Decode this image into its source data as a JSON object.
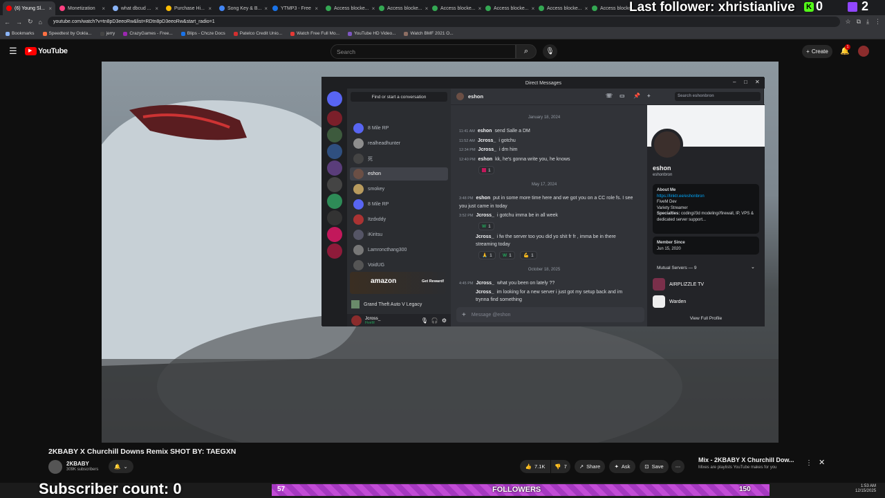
{
  "browser": {
    "tabs": [
      {
        "label": "(6) Young Sl...",
        "color": "#ff0000"
      },
      {
        "label": "Monetization",
        "color": "#ff4081"
      },
      {
        "label": "what dbcud ...",
        "color": "#8ab4f8"
      },
      {
        "label": "Purchase Hi...",
        "color": "#fbbc04"
      },
      {
        "label": "Song Key & B...",
        "color": "#4285f4"
      },
      {
        "label": "YTMP3 - Free",
        "color": "#1a73e8"
      },
      {
        "label": "Access blocke...",
        "color": "#34a853"
      },
      {
        "label": "Access blocke...",
        "color": "#34a853"
      },
      {
        "label": "Access blocke...",
        "color": "#34a853"
      },
      {
        "label": "Access blocke...",
        "color": "#34a853"
      },
      {
        "label": "Access blocke...",
        "color": "#34a853"
      },
      {
        "label": "Access blocke...",
        "color": "#34a853"
      }
    ],
    "url": "youtube.com/watch?v=tn8pD3eeoRw&list=RDtn8pD3eeoRw&start_radio=1",
    "bookmarks": [
      "Bookmarks",
      "Speedtest by Ookla...",
      "jerry",
      "CrazyGames - Free...",
      "Blips - Chcze Docs",
      "Patelco Credit Unio...",
      "Watch Free Full Mo...",
      "YouTube HD Video...",
      "Watch BMF 2021 O..."
    ]
  },
  "overlay": {
    "last_follower": "Last follower: xhristianlive",
    "k_count": "0",
    "twitch_count": "2",
    "subscriber_count": "Subscriber count: 0",
    "goal_current": "57",
    "goal_label": "FOLLOWERS",
    "goal_target": "150"
  },
  "youtube": {
    "logo": "YouTube",
    "search_placeholder": "Search",
    "create_label": "Create",
    "notif_count": "1",
    "video_title": "2KBABY X Churchill Downs Remix SHOT BY: TAEGXN",
    "channel": "2KBABY",
    "subscribers": "309K subscribers",
    "likes": "7.1K",
    "dislikes": "7",
    "share": "Share",
    "ask": "Ask",
    "save": "Save",
    "mix_title": "Mix - 2KBABY X Churchill Dow...",
    "mix_subtitle": "Mixes are playlists YouTube makes for you"
  },
  "discord": {
    "window_title": "Direct Messages",
    "find_conversation": "Find or start a conversation",
    "dms": [
      {
        "name": "8 Mile RP",
        "color": "#5865f2"
      },
      {
        "name": "realheadhunter",
        "color": "#8e8e8e"
      },
      {
        "name": "死",
        "color": "#444"
      },
      {
        "name": "eshon",
        "color": "#6b4f45"
      },
      {
        "name": "smokey",
        "color": "#b89b5e"
      },
      {
        "name": "8 Mile RP",
        "color": "#5865f2"
      },
      {
        "name": "Itzdxddy",
        "color": "#a33"
      },
      {
        "name": "iKiritsu",
        "color": "#556"
      },
      {
        "name": "Lamroncthang300",
        "color": "#777"
      },
      {
        "name": "VoidUG",
        "color": "#555"
      }
    ],
    "promo_brand": "amazon",
    "promo_button": "Get Reward!",
    "activity": "Grand Theft Auto V Legacy",
    "me_name": "Jcross_",
    "me_status": "FiveM",
    "chat_name": "eshon",
    "chat_search": "Search eshonbron",
    "date1": "January 18, 2024",
    "date2": "May 17, 2024",
    "date3": "October 18, 2025",
    "messages": [
      {
        "time": "11:41 AM",
        "author": "eshon",
        "text": "send Salle a DM"
      },
      {
        "time": "11:52 AM",
        "author": "Jcross_",
        "text": "i gotchu"
      },
      {
        "time": "12:34 PM",
        "author": "Jcross_",
        "text": "i dm him"
      },
      {
        "time": "12:40 PM",
        "author": "eshon",
        "text": "kk, he's gonna write you, he knows"
      },
      {
        "time": "3:48 PM",
        "author": "eshon",
        "text": "put in some more time here and we got you on a CC role fs. I see you just came in today"
      },
      {
        "time": "3:52 PM",
        "author": "Jcross_",
        "text": "i gotchu imma be in all week"
      },
      {
        "time": "",
        "author": "Jcross_",
        "text": "i fw the server too you did yo shit fr fr , imma be in there streaming today"
      },
      {
        "time": "4:45 PM",
        "author": "Jcross_",
        "text": "what you been on lately ??"
      },
      {
        "time": "",
        "author": "Jcross_",
        "text": "im looking for a new server i just got my setup back and im trynna find something"
      }
    ],
    "reaction_count": "1",
    "message_placeholder": "Message @eshon",
    "profile_name": "eshon",
    "profile_handle": "eshonbron",
    "about_me_label": "About Me",
    "about_link": "https://linktr.ee/eshonbron",
    "about_lines": [
      "FiveM Dev",
      "Variety Streamer"
    ],
    "specialties_label": "Specialties:",
    "specialties": "coding//3d modeling//firewall, IP, VPS & dedicated server support...",
    "member_since_label": "Member Since",
    "member_since": "Jun 15, 2020",
    "mutual_label": "Mutual Servers — 9",
    "mutual": [
      "AIRPLIZZLE TV",
      "Warden"
    ],
    "view_profile": "View Full Profile"
  },
  "clock": {
    "time": "1:53 AM",
    "date": "12/15/2025"
  }
}
